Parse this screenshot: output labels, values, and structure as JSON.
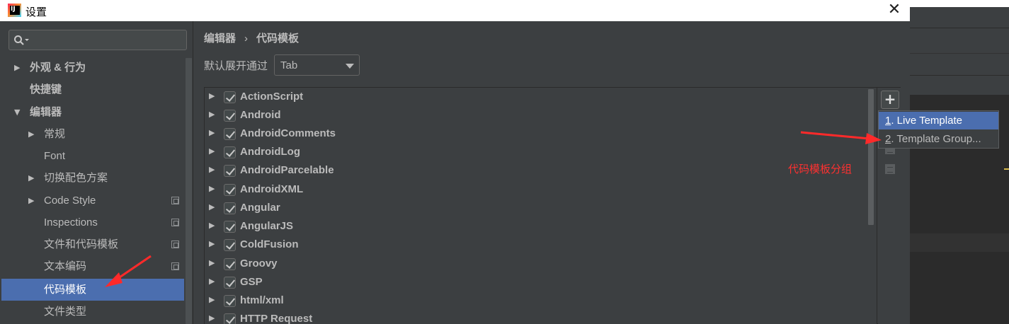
{
  "window": {
    "title": "设置",
    "close_glyph": "✕"
  },
  "sidebar": {
    "search_placeholder": "",
    "items": [
      {
        "label": "外观 & 行为",
        "arrow": "▶",
        "bold": true
      },
      {
        "label": "快捷键",
        "arrow": "",
        "bold": true
      },
      {
        "label": "编辑器",
        "arrow": "▼",
        "bold": true
      },
      {
        "label": "常规",
        "arrow": "▶",
        "bold": false
      },
      {
        "label": "Font",
        "arrow": "",
        "bold": false
      },
      {
        "label": "切换配色方案",
        "arrow": "▶",
        "bold": false
      },
      {
        "label": "Code Style",
        "arrow": "▶",
        "bold": false,
        "copy_icon": true
      },
      {
        "label": "Inspections",
        "arrow": "",
        "bold": false,
        "copy_icon": true
      },
      {
        "label": "文件和代码模板",
        "arrow": "",
        "bold": false,
        "copy_icon": true
      },
      {
        "label": "文本编码",
        "arrow": "",
        "bold": false,
        "copy_icon": true
      },
      {
        "label": "代码模板",
        "arrow": "",
        "bold": false,
        "selected": true
      },
      {
        "label": "文件类型",
        "arrow": "",
        "bold": false
      }
    ]
  },
  "breadcrumb": {
    "parent": "编辑器",
    "separator": "›",
    "current": "代码模板"
  },
  "expand": {
    "label": "默认展开通过",
    "value": "Tab"
  },
  "template_groups": [
    {
      "name": "ActionScript",
      "checked": true
    },
    {
      "name": "Android",
      "checked": true
    },
    {
      "name": "AndroidComments",
      "checked": true
    },
    {
      "name": "AndroidLog",
      "checked": true
    },
    {
      "name": "AndroidParcelable",
      "checked": true
    },
    {
      "name": "AndroidXML",
      "checked": true
    },
    {
      "name": "Angular",
      "checked": true
    },
    {
      "name": "AngularJS",
      "checked": true
    },
    {
      "name": "ColdFusion",
      "checked": true
    },
    {
      "name": "Groovy",
      "checked": true
    },
    {
      "name": "GSP",
      "checked": true
    },
    {
      "name": "html/xml",
      "checked": true
    },
    {
      "name": "HTTP Request",
      "checked": true
    }
  ],
  "toolbar": {
    "add_glyph": "+"
  },
  "popup_menu": {
    "items": [
      {
        "mnemonic": "1",
        "label": ". Live Template",
        "highlighted": true
      },
      {
        "mnemonic": "2",
        "label": ". Template Group...",
        "highlighted": false
      }
    ]
  },
  "annotation": {
    "text": "代码模板分组",
    "color": "#ff3030"
  },
  "colors": {
    "selection": "#4b6eaf",
    "panel": "#3c3f41",
    "text": "#bbbbbb"
  }
}
